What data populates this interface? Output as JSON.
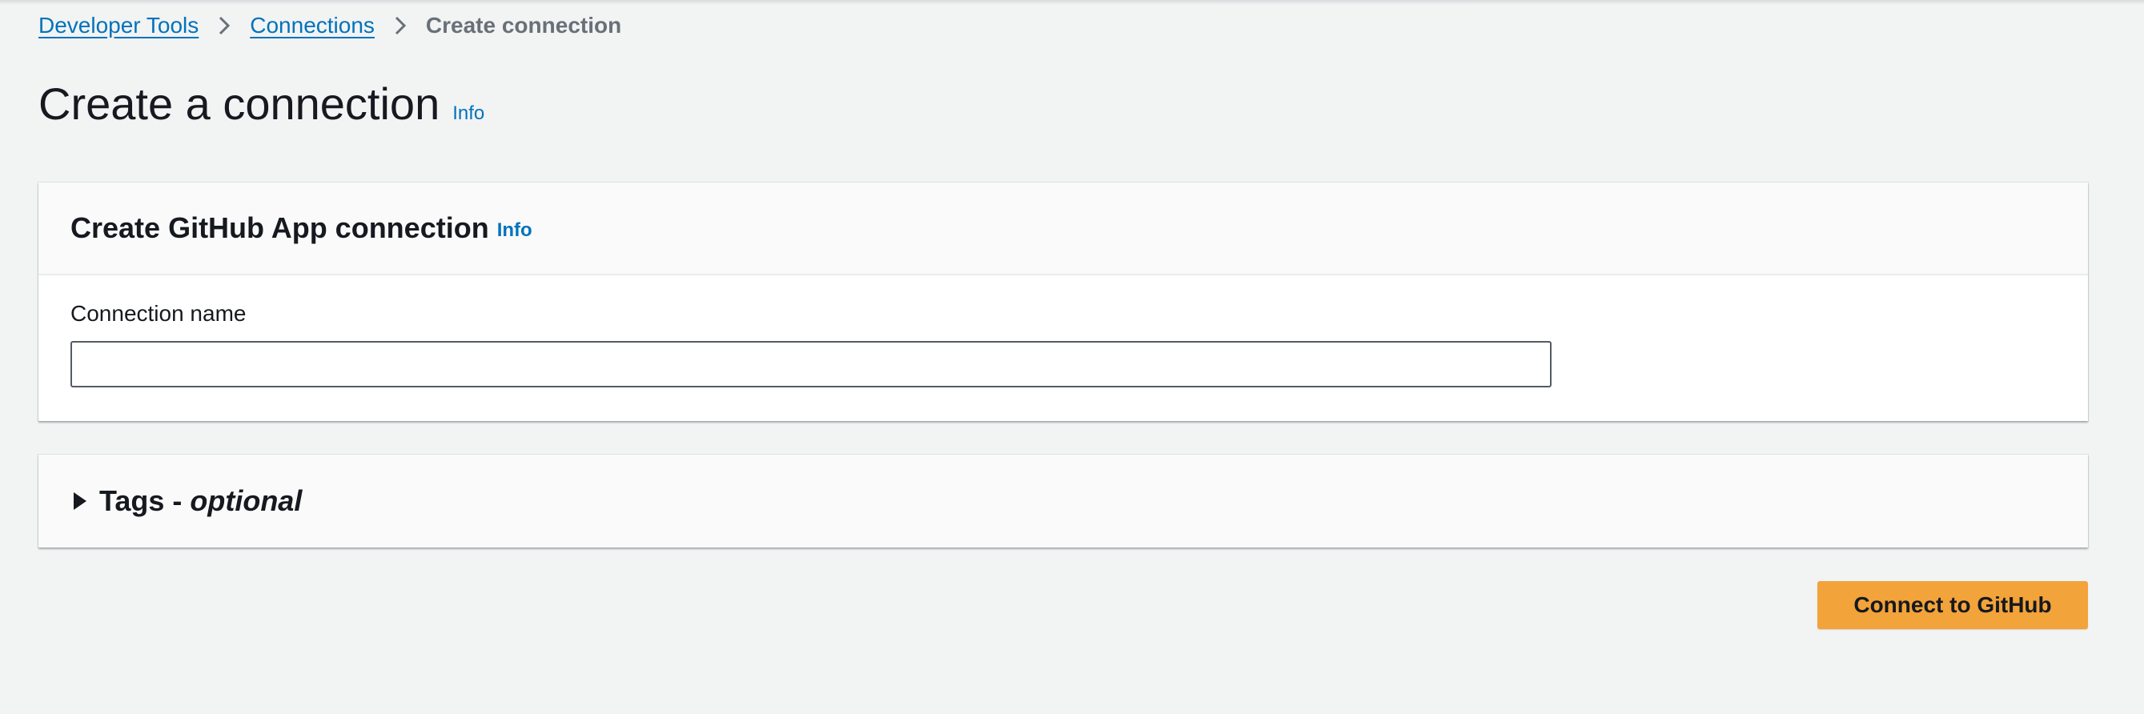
{
  "breadcrumb": {
    "items": [
      {
        "label": "Developer Tools"
      },
      {
        "label": "Connections"
      },
      {
        "label": "Create connection"
      }
    ]
  },
  "page": {
    "title": "Create a connection",
    "info_label": "Info"
  },
  "main_panel": {
    "title": "Create GitHub App connection",
    "info_label": "Info",
    "connection_name_label": "Connection name",
    "connection_name_value": "",
    "connection_name_placeholder": ""
  },
  "tags_panel": {
    "title": "Tags",
    "dash": " - ",
    "optional_label": "optional",
    "expanded": false
  },
  "actions": {
    "connect_label": "Connect to GitHub"
  },
  "colors": {
    "link": "#0073bb",
    "primary_button": "#f2a33a",
    "background": "#f2f3f3"
  },
  "icons": {
    "breadcrumb_separator": "chevron-right-icon",
    "tags_toggle": "caret-right-icon"
  }
}
